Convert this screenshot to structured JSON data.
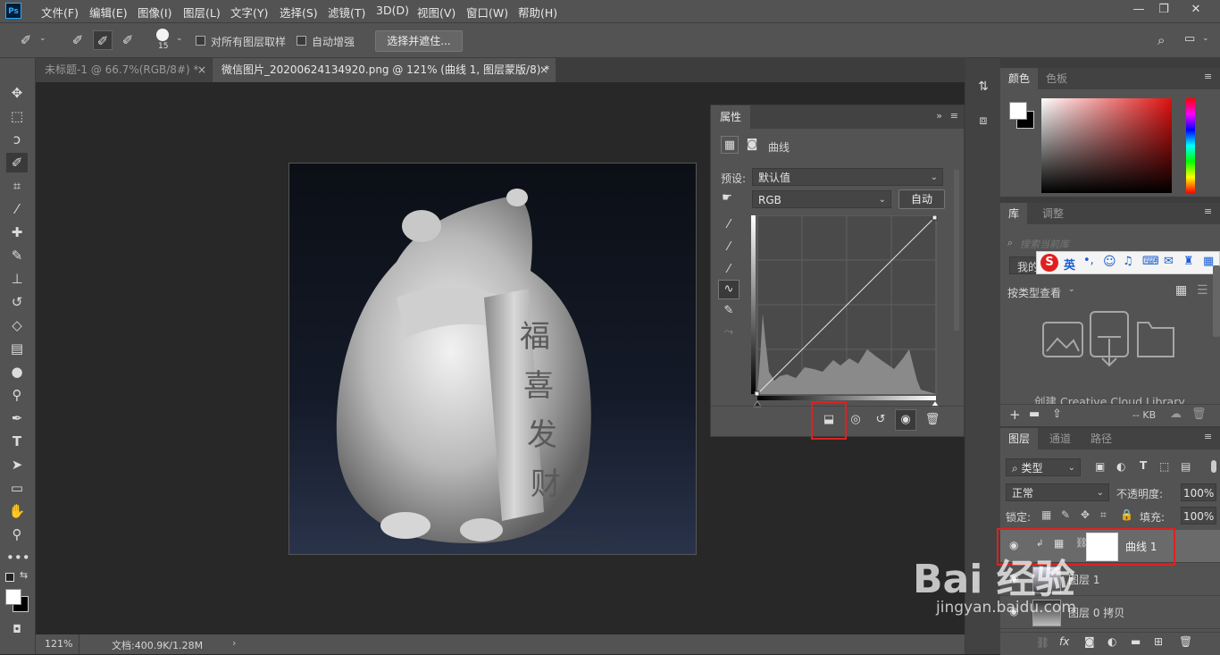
{
  "app": {
    "logo": "Ps"
  },
  "menubar": {
    "items": [
      "文件(F)",
      "编辑(E)",
      "图像(I)",
      "图层(L)",
      "文字(Y)",
      "选择(S)",
      "滤镜(T)",
      "3D(D)",
      "视图(V)",
      "窗口(W)",
      "帮助(H)"
    ],
    "window_controls": [
      "minimize-icon",
      "restore-icon",
      "close-icon"
    ]
  },
  "options": {
    "brush_size": "15",
    "sample_all_layers": "对所有图层取样",
    "auto_enhance": "自动增强",
    "select_mask_button": "选择并遮住..."
  },
  "tabs": [
    {
      "label": "未标题-1 @ 66.7%(RGB/8#) *",
      "active": false
    },
    {
      "label": "微信图片_20200624134920.png @ 121% (曲线 1, 图层蒙版/8) *",
      "active": true
    }
  ],
  "status": {
    "zoom": "121%",
    "doc": "文档:400.9K/1.28M"
  },
  "properties": {
    "tab": "属性",
    "title": "曲线",
    "preset_label": "预设:",
    "preset_value": "默认值",
    "channel": "RGB",
    "auto_button": "自动"
  },
  "document": {
    "vertical_text": [
      "福",
      "喜",
      "发",
      "财"
    ]
  },
  "color_panel": {
    "tabs": [
      "颜色",
      "色板"
    ]
  },
  "library_panel": {
    "tabs": [
      "库",
      "调整"
    ],
    "search_placeholder": "搜索当前库",
    "my_library": "我的",
    "view_by": "按类型查看",
    "create_cc": "创建 Creative Cloud Library",
    "kb": "-- KB",
    "ime_items": [
      "英",
      "•,"
    ]
  },
  "layers_panel": {
    "tabs": [
      "图层",
      "通道",
      "路径"
    ],
    "filter": "类型",
    "blend_mode": "正常",
    "opacity_label": "不透明度:",
    "opacity_value": "100%",
    "lock_label": "锁定:",
    "fill_label": "填充:",
    "fill_value": "100%",
    "layers": [
      {
        "name": "曲线 1",
        "selected": true
      },
      {
        "name": "图层 1",
        "selected": false
      },
      {
        "name": "图层 0 拷贝",
        "selected": false
      }
    ]
  },
  "watermark": {
    "brand": "Bai 经验",
    "url": "jingyan.baidu.com"
  },
  "colors": {
    "accent_highlight": "#e02020",
    "ui_bg": "#535353",
    "dark_bg": "#282828"
  }
}
